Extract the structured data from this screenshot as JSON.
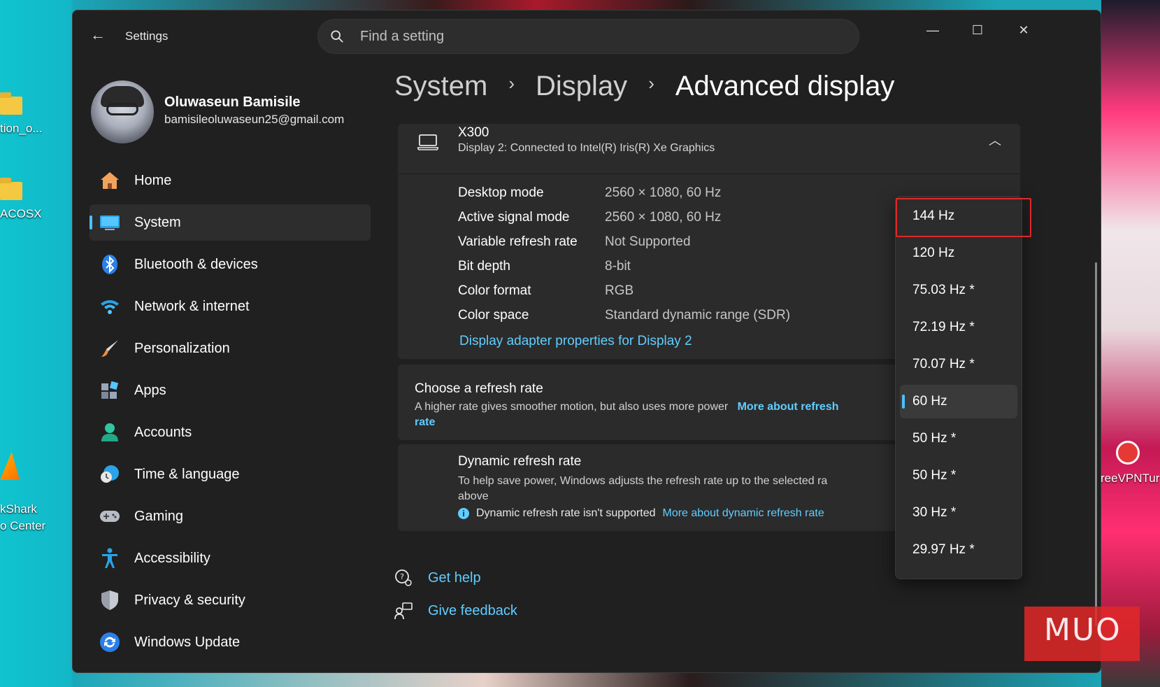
{
  "desktop": {
    "left_icons": [
      {
        "label": "tion_o..."
      },
      {
        "label": "ACOSX"
      },
      {
        "label": "kShark\no Center"
      }
    ],
    "right_icons": [
      {
        "label": "reeVPNTur"
      }
    ],
    "watermark": "MUO"
  },
  "titlebar": {
    "app_title": "Settings",
    "search_placeholder": "Find a setting",
    "buttons": {
      "minimize": "—",
      "maximize": "☐",
      "close": "✕"
    }
  },
  "user": {
    "name": "Oluwaseun Bamisile",
    "email": "bamisileoluwaseun25@gmail.com"
  },
  "sidebar": {
    "items": [
      {
        "label": "Home",
        "icon": "home-icon"
      },
      {
        "label": "System",
        "icon": "system-icon",
        "active": true
      },
      {
        "label": "Bluetooth & devices",
        "icon": "bluetooth-icon"
      },
      {
        "label": "Network & internet",
        "icon": "wifi-icon"
      },
      {
        "label": "Personalization",
        "icon": "brush-icon"
      },
      {
        "label": "Apps",
        "icon": "apps-icon"
      },
      {
        "label": "Accounts",
        "icon": "accounts-icon"
      },
      {
        "label": "Time & language",
        "icon": "clock-globe-icon"
      },
      {
        "label": "Gaming",
        "icon": "gamepad-icon"
      },
      {
        "label": "Accessibility",
        "icon": "accessibility-icon"
      },
      {
        "label": "Privacy & security",
        "icon": "shield-icon"
      },
      {
        "label": "Windows Update",
        "icon": "update-icon"
      }
    ]
  },
  "breadcrumb": {
    "items": [
      "System",
      "Display"
    ],
    "separator": "›",
    "current": "Advanced display"
  },
  "display_card": {
    "name": "X300",
    "subtitle": "Display 2: Connected to Intel(R) Iris(R) Xe Graphics",
    "rows": [
      {
        "label": "Desktop mode",
        "value": "2560 × 1080, 60 Hz"
      },
      {
        "label": "Active signal mode",
        "value": "2560 × 1080, 60 Hz"
      },
      {
        "label": "Variable refresh rate",
        "value": "Not Supported"
      },
      {
        "label": "Bit depth",
        "value": "8-bit"
      },
      {
        "label": "Color format",
        "value": "RGB"
      },
      {
        "label": "Color space",
        "value": "Standard dynamic range (SDR)"
      }
    ],
    "adapter_link": "Display adapter properties for Display 2"
  },
  "refresh_card": {
    "title": "Choose a refresh rate",
    "description": "A higher rate gives smoother motion, but also uses more power",
    "link": "More about refresh rate"
  },
  "dynamic_card": {
    "title": "Dynamic refresh rate",
    "description_line1": "To help save power, Windows adjusts the refresh rate up to the selected ra",
    "description_line2": "above",
    "note": "Dynamic refresh rate isn't supported",
    "link": "More about dynamic refresh rate"
  },
  "refresh_dropdown": {
    "options": [
      "144 Hz",
      "120 Hz",
      "75.03 Hz *",
      "72.19 Hz *",
      "70.07 Hz *",
      "60 Hz",
      "50 Hz *",
      "50 Hz *",
      "30 Hz *",
      "29.97 Hz *"
    ],
    "selected": "60 Hz",
    "highlighted": "144 Hz"
  },
  "help_links": {
    "get_help": "Get help",
    "give_feedback": "Give feedback"
  },
  "colors": {
    "accent": "#4cc2ff",
    "link": "#60cdff",
    "window_bg": "#202020",
    "card_bg": "#2b2b2b",
    "highlight_box": "#e02828"
  }
}
